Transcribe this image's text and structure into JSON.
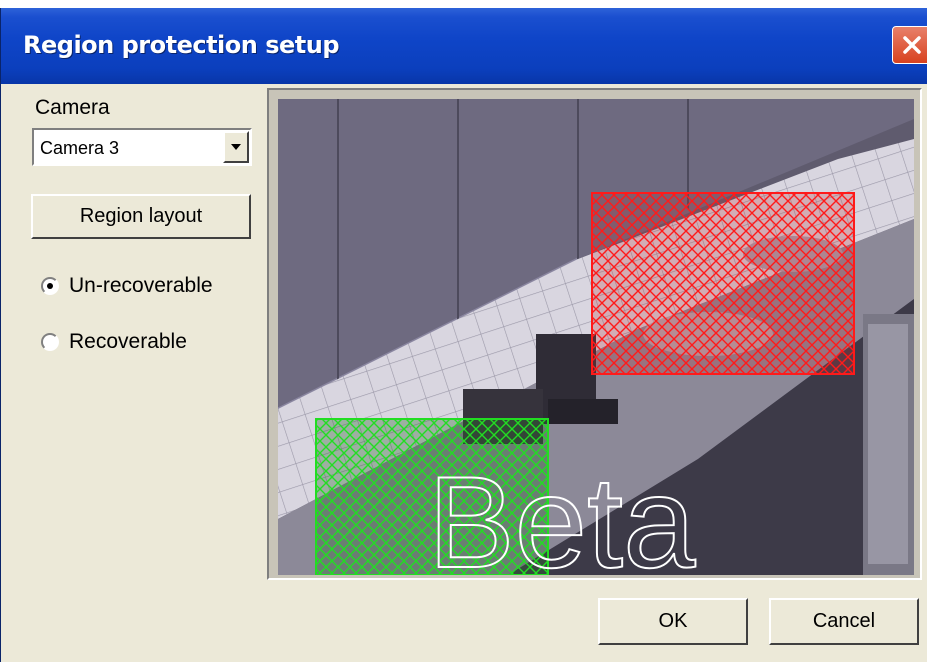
{
  "window": {
    "title": "Region protection setup"
  },
  "left_panel": {
    "camera_label": "Camera",
    "camera_select": {
      "value": "Camera 3"
    },
    "region_layout_button": "Region layout",
    "radios": [
      {
        "label": "Un-recoverable",
        "checked": true
      },
      {
        "label": "Recoverable",
        "checked": false
      }
    ]
  },
  "preview": {
    "watermark": "Beta",
    "regions": [
      {
        "name": "red-region",
        "color": "#ff1a1a"
      },
      {
        "name": "green-region",
        "color": "#22dd22"
      }
    ]
  },
  "buttons": {
    "ok": "OK",
    "cancel": "Cancel"
  }
}
